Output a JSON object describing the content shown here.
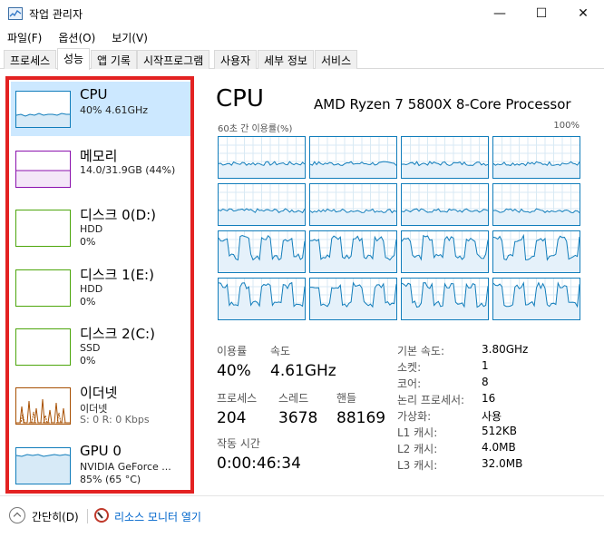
{
  "window": {
    "title": "작업 관리자",
    "minimize": "—",
    "maximize": "☐",
    "close": "✕"
  },
  "menu": {
    "file": "파일(F)",
    "options": "옵션(O)",
    "view": "보기(V)"
  },
  "tabs": [
    "프로세스",
    "성능",
    "앱 기록",
    "시작프로그램",
    "사용자",
    "세부 정보",
    "서비스"
  ],
  "active_tab": "성능",
  "sidebar": {
    "items": [
      {
        "name": "CPU",
        "line1": "40% 4.61GHz",
        "line2": ""
      },
      {
        "name": "메모리",
        "line1": "14.0/31.9GB (44%)",
        "line2": ""
      },
      {
        "name": "디스크 0(D:)",
        "line1": "HDD",
        "line2": "0%"
      },
      {
        "name": "디스크 1(E:)",
        "line1": "HDD",
        "line2": "0%"
      },
      {
        "name": "디스크 2(C:)",
        "line1": "SSD",
        "line2": "0%"
      },
      {
        "name": "이더넷",
        "line1": "이더넷",
        "line2": "S: 0  R: 0 Kbps"
      },
      {
        "name": "GPU 0",
        "line1": "NVIDIA GeForce ...",
        "line2": "85% (65 °C)"
      }
    ],
    "colors": {
      "cpu": "#117dbb",
      "memory": "#8b12ae",
      "disk": "#4da60c",
      "ethernet": "#a74f01",
      "gpu": "#117dbb"
    }
  },
  "cpu": {
    "title": "CPU",
    "model": "AMD Ryzen 7 5800X 8-Core Processor",
    "graph_label_left": "60초 간 이용률(%)",
    "graph_label_right": "100%",
    "logical_processors": 16,
    "stats": {
      "utilization_label": "이용률",
      "utilization": "40%",
      "speed_label": "속도",
      "speed": "4.61GHz",
      "processes_label": "프로세스",
      "processes": "204",
      "threads_label": "스레드",
      "threads": "3678",
      "handles_label": "핸들",
      "handles": "88169",
      "uptime_label": "작동 시간",
      "uptime": "0:00:46:34"
    },
    "specs": [
      {
        "label": "기본 속도:",
        "value": "3.80GHz"
      },
      {
        "label": "소켓:",
        "value": "1"
      },
      {
        "label": "코어:",
        "value": "8"
      },
      {
        "label": "논리 프로세서:",
        "value": "16"
      },
      {
        "label": "가상화:",
        "value": "사용"
      },
      {
        "label": "L1 캐시:",
        "value": "512KB"
      },
      {
        "label": "L2 캐시:",
        "value": "4.0MB"
      },
      {
        "label": "L3 캐시:",
        "value": "32.0MB"
      }
    ]
  },
  "footer": {
    "fewer_details": "간단히(D)",
    "resource_monitor": "리소스 모니터 열기"
  }
}
